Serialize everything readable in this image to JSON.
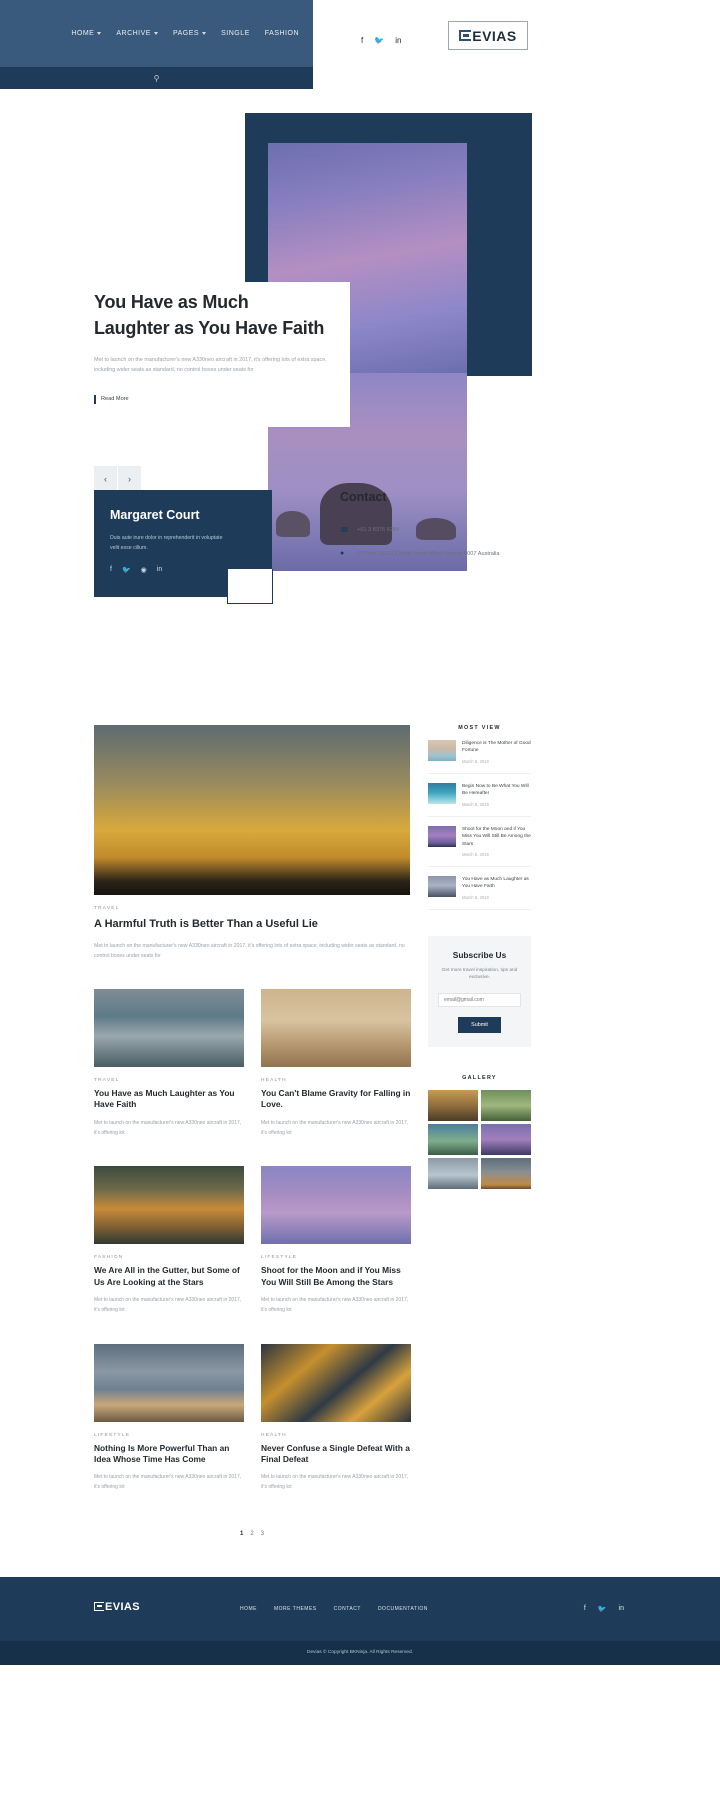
{
  "header": {
    "nav": [
      {
        "label": "HOME",
        "caret": true
      },
      {
        "label": "ARCHIVE",
        "caret": true
      },
      {
        "label": "PAGES",
        "caret": true
      },
      {
        "label": "SINGLE",
        "caret": false
      },
      {
        "label": "FASHION",
        "caret": false
      }
    ],
    "search_icon": "search-icon",
    "social": [
      "facebook-icon",
      "twitter-icon",
      "linkedin-icon"
    ],
    "logo_text": "EVIAS"
  },
  "hero": {
    "title_line1": "You Have as Much",
    "title_line2": "Laughter as You Have Faith",
    "excerpt": "Met to launch on the manufacturer's new A330neo aircraft in 2017, it's offering lots of extra space, including wider seats as standard, no control boxes under seats for",
    "read_more": "Read More",
    "prev": "‹",
    "next": "›"
  },
  "author": {
    "name": "Margaret Court",
    "desc": "Duis aute irure dolor in reprehenderit in voluptate velit esse cillum.",
    "social": [
      "facebook-icon",
      "twitter-icon",
      "instagram-icon",
      "linkedin-icon"
    ]
  },
  "contact": {
    "title": "Contact",
    "phone": "+61 3 8376 6284",
    "address": "PO Box 16122 Collins Street West Victoria 8007 Australia"
  },
  "blog": {
    "featured": {
      "category": "TRAVEL",
      "title": "A Harmful Truth is Better Than a Useful Lie",
      "excerpt": "Met to launch on the manufacturer's new A330neo aircraft in 2017, it's offering lots of extra space, including wider seats as standard, no control boxes under seats for"
    },
    "posts": [
      {
        "category": "TRAVEL",
        "title": "You Have as Much Laughter as You Have Faith",
        "excerpt": "Met to launch on the manufacturer's new A330neo aircraft in 2017, it's offering lot"
      },
      {
        "category": "HEALTH",
        "title": "You Can't Blame Gravity for Falling in Love.",
        "excerpt": "Met to launch on the manufacturer's new A330neo aircraft in 2017, it's offering lot"
      },
      {
        "category": "FASHION",
        "title": "We Are All in the Gutter, but Some of Us Are Looking at the Stars",
        "excerpt": "Met to launch on the manufacturer's new A330neo aircraft in 2017, it's offering lot"
      },
      {
        "category": "LIFESTYLE",
        "title": "Shoot for the Moon and if You Miss You Will Still Be Among the Stars",
        "excerpt": "Met to launch on the manufacturer's new A330neo aircraft in 2017, it's offering lot"
      },
      {
        "category": "LIFESTYLE",
        "title": "Nothing Is More Powerful Than an Idea Whose Time Has Come",
        "excerpt": "Met to launch on the manufacturer's new A330neo aircraft in 2017, it's offering lot"
      },
      {
        "category": "HEALTH",
        "title": "Never Confuse a Single Defeat With a Final Defeat",
        "excerpt": "Met to launch on the manufacturer's new A330neo aircraft in 2017, it's offering lot"
      }
    ],
    "pagination": [
      "1",
      "2",
      "3"
    ]
  },
  "sidebar": {
    "most_view_heading": "MOST VIEW",
    "most_view": [
      {
        "title": "Diligence is The Mother of Good Fortune",
        "date": "March 6, 2019"
      },
      {
        "title": "Begin Now to Be What You Will Be Hereafter",
        "date": "March 6, 2019"
      },
      {
        "title": "Shoot for the Moon and if You Miss You Will Still Be Among the Stars",
        "date": "March 6, 2019"
      },
      {
        "title": "You Have as Much Laughter as You Have Faith",
        "date": "March 6, 2019"
      }
    ],
    "subscribe": {
      "heading": "Subscribe Us",
      "desc": "Get more travel inspiration, tips and exclusive.",
      "placeholder": "email@gmail.com",
      "button": "Submit"
    },
    "gallery_heading": "GALLERY"
  },
  "footer": {
    "logo_text": "EVIAS",
    "nav": [
      "HOME",
      "MORE THEMES",
      "CONTACT",
      "DOCUMENTATION"
    ],
    "social": [
      "facebook-icon",
      "twitter-icon",
      "linkedin-icon"
    ],
    "copyright": "Devias © Copyright BKNinja. All Rights Reserved."
  },
  "colors": {
    "brand_dark": "#1e3c5a",
    "brand_mid": "#3a5a7d",
    "text": "#24292e",
    "muted": "#9aa0a6"
  }
}
